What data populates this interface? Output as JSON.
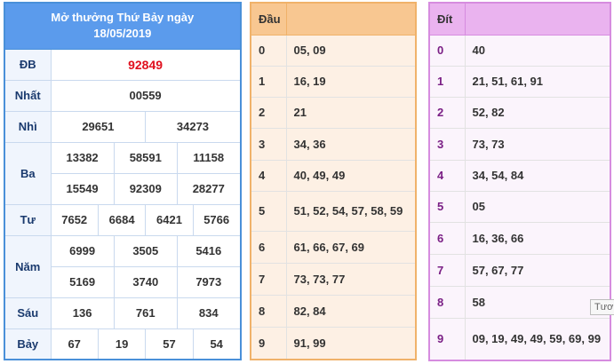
{
  "results": {
    "title_line1": "Mở thưởng Thứ Bảy ngày",
    "title_line2": "18/05/2019",
    "rows": {
      "db": {
        "label": "ĐB",
        "values": [
          "92849"
        ]
      },
      "nhat": {
        "label": "Nhất",
        "values": [
          "00559"
        ]
      },
      "nhi": {
        "label": "Nhì",
        "values": [
          "29651",
          "34273"
        ]
      },
      "ba": {
        "label": "Ba",
        "values": [
          "13382",
          "58591",
          "11158",
          "15549",
          "92309",
          "28277"
        ]
      },
      "tu": {
        "label": "Tư",
        "values": [
          "7652",
          "6684",
          "6421",
          "5766"
        ]
      },
      "nam": {
        "label": "Năm",
        "values": [
          "6999",
          "3505",
          "5416",
          "5169",
          "3740",
          "7973"
        ]
      },
      "sau": {
        "label": "Sáu",
        "values": [
          "136",
          "761",
          "834"
        ]
      },
      "bay": {
        "label": "Bảy",
        "values": [
          "67",
          "19",
          "57",
          "54"
        ]
      }
    },
    "colors": {
      "header": "#5b9bec",
      "special": "#e0101e",
      "border": "#4a90d9"
    }
  },
  "dau": {
    "header": "Đầu",
    "rows": [
      {
        "idx": "0",
        "vals": "05, 09"
      },
      {
        "idx": "1",
        "vals": "16, 19"
      },
      {
        "idx": "2",
        "vals": "21"
      },
      {
        "idx": "3",
        "vals": "34, 36"
      },
      {
        "idx": "4",
        "vals": "40, 49, 49"
      },
      {
        "idx": "5",
        "vals": "51, 52, 54, 57, 58, 59"
      },
      {
        "idx": "6",
        "vals": "61, 66, 67, 69"
      },
      {
        "idx": "7",
        "vals": "73, 73, 77"
      },
      {
        "idx": "8",
        "vals": "82, 84"
      },
      {
        "idx": "9",
        "vals": "91, 99"
      }
    ],
    "colors": {
      "header": "#f8c791",
      "body": "#fdf0e4",
      "border": "#f0b26a"
    }
  },
  "dit": {
    "header": "Đít",
    "rows": [
      {
        "idx": "0",
        "vals": "40"
      },
      {
        "idx": "1",
        "vals": "21, 51, 61, 91"
      },
      {
        "idx": "2",
        "vals": "52, 82"
      },
      {
        "idx": "3",
        "vals": "73, 73"
      },
      {
        "idx": "4",
        "vals": "34, 54, 84"
      },
      {
        "idx": "5",
        "vals": "05"
      },
      {
        "idx": "6",
        "vals": "16, 36, 66"
      },
      {
        "idx": "7",
        "vals": "57, 67, 77"
      },
      {
        "idx": "8",
        "vals": "58"
      },
      {
        "idx": "9",
        "vals": "09, 19, 49, 49, 59, 69, 99"
      }
    ],
    "colors": {
      "header": "#eab3ef",
      "body": "#fbf4fc",
      "border": "#d68cdf"
    }
  },
  "tooltip": {
    "text": "Tươ"
  }
}
